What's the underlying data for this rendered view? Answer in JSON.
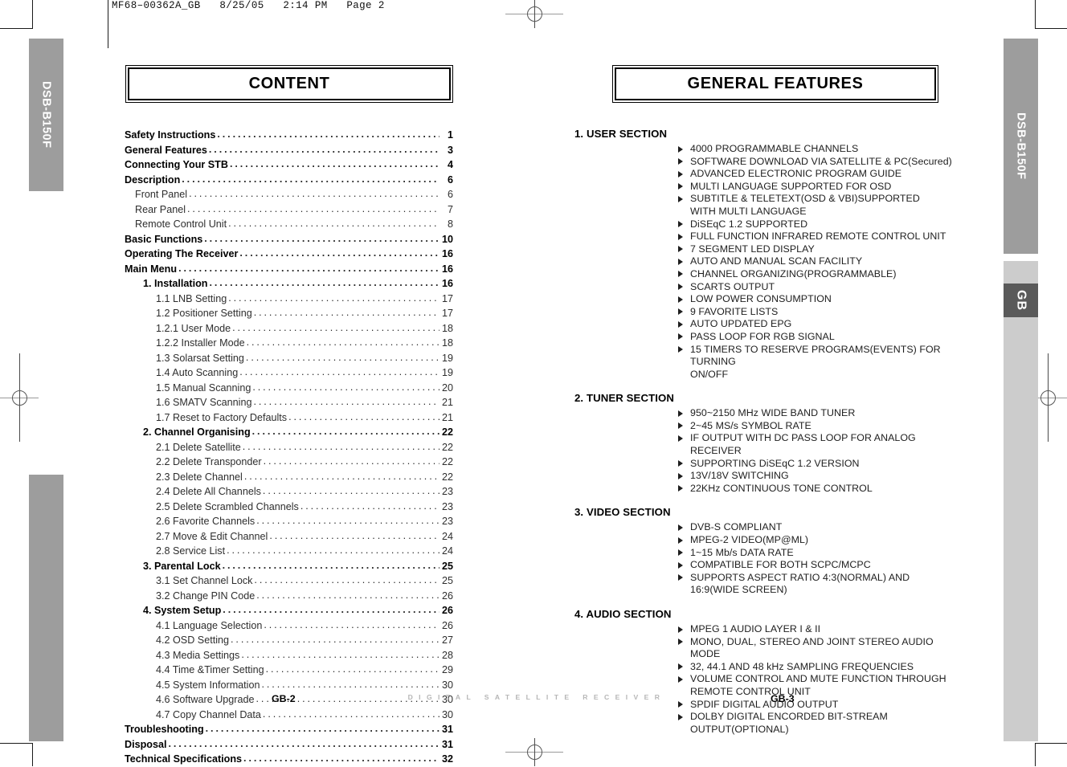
{
  "print_header": "MF68–00362A_GB   8/25/05   2:14 PM   Page 2",
  "side_tabs": {
    "left_model": "DSB-B150F",
    "right_model": "DSB-B150F",
    "right_language": "GB"
  },
  "colors": {
    "tab_gray": "#9d9d9d",
    "tab_pale": "#cccccc",
    "tab_dark": "#5a5a5a",
    "footer_watermark": "#b6b6b6",
    "text": "#1a1a1a"
  },
  "left_page": {
    "title": "CONTENT",
    "footer_page": "GB-2",
    "toc": [
      {
        "level": 0,
        "label": "Safety Instructions",
        "page": "1"
      },
      {
        "level": 0,
        "label": "General Features",
        "page": "3"
      },
      {
        "level": 0,
        "label": "Connecting Your STB",
        "page": "4"
      },
      {
        "level": 0,
        "label": "Description",
        "page": "6"
      },
      {
        "level": 1,
        "label": "Front Panel",
        "page": "6"
      },
      {
        "level": 1,
        "label": "Rear Panel",
        "page": "7"
      },
      {
        "level": 1,
        "label": "Remote Control Unit",
        "page": "8"
      },
      {
        "level": 0,
        "label": "Basic Functions",
        "page": "10"
      },
      {
        "level": 0,
        "label": "Operating The Receiver",
        "page": "16"
      },
      {
        "level": 0,
        "label": "Main Menu",
        "page": "16"
      },
      {
        "level": 2,
        "label": "1. Installation",
        "page": "16"
      },
      {
        "level": 3,
        "label": "1.1  LNB Setting",
        "page": "17"
      },
      {
        "level": 3,
        "label": "1.2  Positioner Setting",
        "page": "17"
      },
      {
        "level": 3,
        "label": "1.2.1  User Mode",
        "page": "18"
      },
      {
        "level": 3,
        "label": "1.2.2  Installer Mode",
        "page": "18"
      },
      {
        "level": 3,
        "label": "1.3  Solarsat Setting",
        "page": "19"
      },
      {
        "level": 3,
        "label": "1.4  Auto Scanning",
        "page": "19"
      },
      {
        "level": 3,
        "label": "1.5  Manual Scanning",
        "page": "20"
      },
      {
        "level": 3,
        "label": "1.6  SMATV Scanning",
        "page": "21"
      },
      {
        "level": 3,
        "label": "1.7  Reset to Factory Defaults",
        "page": "21"
      },
      {
        "level": 2,
        "label": "2. Channel Organising",
        "page": "22"
      },
      {
        "level": 3,
        "label": "2.1  Delete Satellite",
        "page": "22"
      },
      {
        "level": 3,
        "label": "2.2  Delete Transponder",
        "page": "22"
      },
      {
        "level": 3,
        "label": "2.3  Delete Channel",
        "page": "22"
      },
      {
        "level": 3,
        "label": "2.4  Delete All Channels",
        "page": "23"
      },
      {
        "level": 3,
        "label": "2.5  Delete Scrambled Channels",
        "page": "23"
      },
      {
        "level": 3,
        "label": "2.6  Favorite Channels",
        "page": "23"
      },
      {
        "level": 3,
        "label": "2.7  Move & Edit Channel",
        "page": "24"
      },
      {
        "level": 3,
        "label": "2.8  Service List",
        "page": "24"
      },
      {
        "level": 2,
        "label": "3. Parental Lock",
        "page": "25"
      },
      {
        "level": 3,
        "label": "3.1  Set Channel Lock",
        "page": "25"
      },
      {
        "level": 3,
        "label": "3.2  Change PIN Code",
        "page": "26"
      },
      {
        "level": 2,
        "label": "4. System Setup",
        "page": "26"
      },
      {
        "level": 3,
        "label": "4.1  Language Selection",
        "page": "26"
      },
      {
        "level": 3,
        "label": "4.2  OSD Setting",
        "page": "27"
      },
      {
        "level": 3,
        "label": "4.3  Media Settings",
        "page": "28"
      },
      {
        "level": 3,
        "label": "4.4  Time &Timer Setting",
        "page": "29"
      },
      {
        "level": 3,
        "label": "4.5  System Information",
        "page": "30"
      },
      {
        "level": 3,
        "label": "4.6  Software Upgrade",
        "page": "30"
      },
      {
        "level": 3,
        "label": "4.7  Copy Channel Data",
        "page": "30"
      },
      {
        "level": 0,
        "label": "Troubleshooting",
        "page": "31"
      },
      {
        "level": 0,
        "label": "Disposal",
        "page": "31"
      },
      {
        "level": 0,
        "label": "Technical Specifications",
        "page": "32"
      }
    ]
  },
  "right_page": {
    "title": "GENERAL FEATURES",
    "footer_page": "GB-3",
    "sections": [
      {
        "heading": "1. USER SECTION",
        "items": [
          {
            "text": "4000 PROGRAMMABLE CHANNELS"
          },
          {
            "text": "SOFTWARE DOWNLOAD VIA SATELLITE & PC(Secured)"
          },
          {
            "text": "ADVANCED ELECTRONIC PROGRAM GUIDE"
          },
          {
            "text": "MULTI LANGUAGE SUPPORTED FOR OSD"
          },
          {
            "text": "SUBTITLE & TELETEXT(OSD & VBI)SUPPORTED",
            "cont": "WITH MULTI LANGUAGE"
          },
          {
            "text": "DiSEqC 1.2 SUPPORTED"
          },
          {
            "text": "FULL FUNCTION INFRARED REMOTE CONTROL UNIT"
          },
          {
            "text": "7 SEGMENT LED DISPLAY"
          },
          {
            "text": "AUTO AND MANUAL SCAN FACILITY"
          },
          {
            "text": "CHANNEL ORGANIZING(PROGRAMMABLE)"
          },
          {
            "text": "SCARTS OUTPUT"
          },
          {
            "text": "LOW POWER CONSUMPTION"
          },
          {
            "text": "9 FAVORITE LISTS"
          },
          {
            "text": "AUTO UPDATED EPG"
          },
          {
            "text": "PASS LOOP FOR RGB SIGNAL"
          },
          {
            "text": "15 TIMERS TO RESERVE PROGRAMS(EVENTS) FOR TURNING",
            "cont": "ON/OFF"
          }
        ]
      },
      {
        "heading": "2. TUNER SECTION",
        "items": [
          {
            "text": "950~2150 MHz WIDE BAND TUNER"
          },
          {
            "text": "2~45 MS/s SYMBOL RATE"
          },
          {
            "text": "IF OUTPUT WITH DC PASS LOOP FOR ANALOG RECEIVER"
          },
          {
            "text": "SUPPORTING DiSEqC 1.2 VERSION"
          },
          {
            "text": "13V/18V SWITCHING"
          },
          {
            "text": "22KHz CONTINUOUS TONE CONTROL"
          }
        ]
      },
      {
        "heading": "3. VIDEO SECTION",
        "items": [
          {
            "text": "DVB-S COMPLIANT"
          },
          {
            "text": "MPEG-2 VIDEO(MP@ML)"
          },
          {
            "text": "1~15 Mb/s DATA RATE"
          },
          {
            "text": "COMPATIBLE FOR BOTH SCPC/MCPC"
          },
          {
            "text": "SUPPORTS ASPECT RATIO 4:3(NORMAL) AND",
            "cont": "16:9(WIDE SCREEN)"
          }
        ]
      },
      {
        "heading": "4. AUDIO SECTION",
        "items": [
          {
            "text": "MPEG 1 AUDIO LAYER I & II"
          },
          {
            "text": "MONO, DUAL, STEREO AND JOINT STEREO AUDIO MODE"
          },
          {
            "text": "32, 44.1 AND 48 kHz SAMPLING FREQUENCIES"
          },
          {
            "text": "VOLUME CONTROL AND MUTE FUNCTION THROUGH",
            "cont": "REMOTE CONTROL UNIT"
          },
          {
            "text": "SPDIF DIGITAL AUDIO OUTPUT"
          },
          {
            "text": "DOLBY DIGITAL ENCORDED BIT-STREAM OUTPUT(OPTIONAL)"
          }
        ]
      }
    ]
  },
  "footer_watermark": "DIGITAL SATELLITE RECEIVER"
}
